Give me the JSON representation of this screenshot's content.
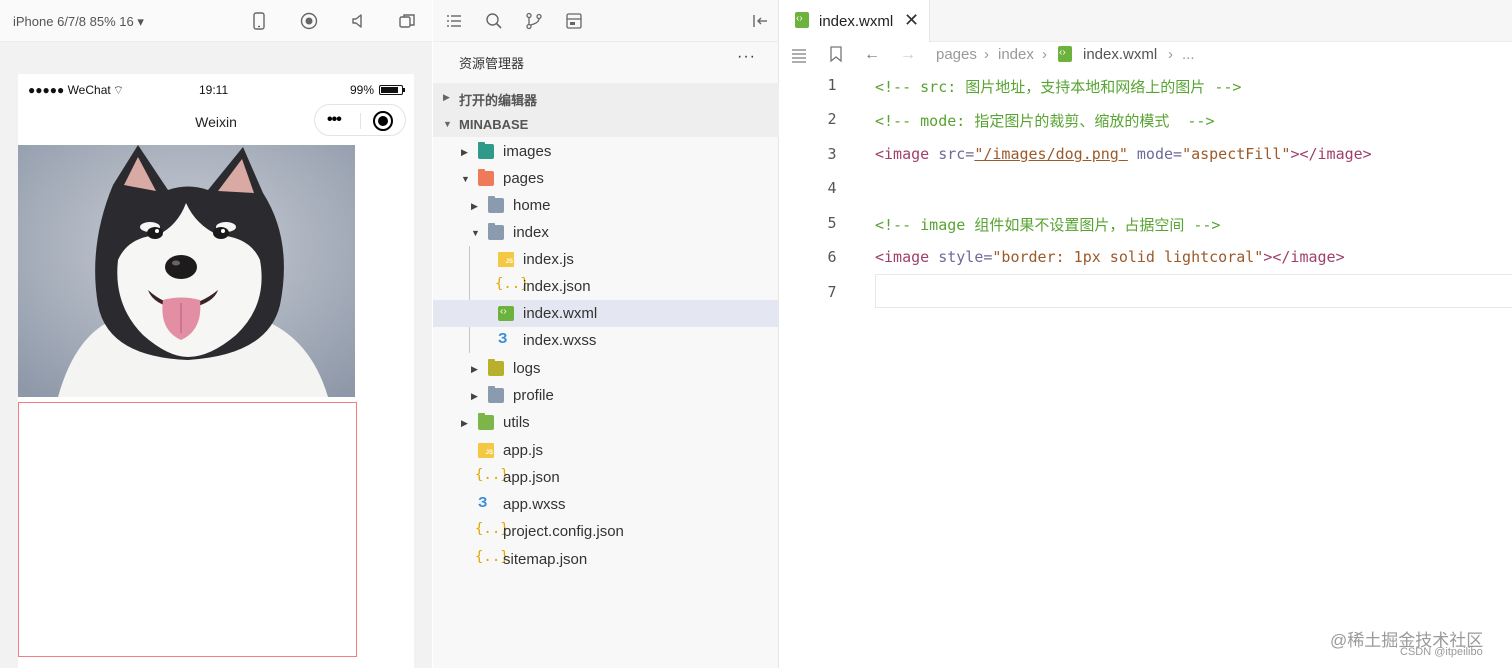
{
  "simulator": {
    "device": "iPhone 6/7/8 85% 16 ▾",
    "statusbar": {
      "carrier": "●●●●● WeChat",
      "time": "19:11",
      "battery": "99%"
    },
    "navbar_title": "Weixin",
    "capsule_dots": "•••"
  },
  "explorer": {
    "title": "资源管理器",
    "more": "···",
    "sections": {
      "open_editors": "打开的编辑器",
      "project": "MINABASE"
    },
    "tree": [
      {
        "name": "images"
      },
      {
        "name": "pages"
      },
      {
        "name": "home"
      },
      {
        "name": "index"
      },
      {
        "name": "index.js"
      },
      {
        "name": "index.json"
      },
      {
        "name": "index.wxml"
      },
      {
        "name": "index.wxss"
      },
      {
        "name": "logs"
      },
      {
        "name": "profile"
      },
      {
        "name": "utils"
      },
      {
        "name": "app.js"
      },
      {
        "name": "app.json"
      },
      {
        "name": "app.wxss"
      },
      {
        "name": "project.config.json"
      },
      {
        "name": "sitemap.json"
      }
    ],
    "selected": "index.wxml"
  },
  "editor": {
    "tab_label": "index.wxml",
    "breadcrumb": {
      "seg1": "pages",
      "seg2": "index",
      "seg3": "index.wxml",
      "ellipsis": "..."
    },
    "lines": [
      {
        "num": "1",
        "text": "<!-- src: 图片地址，支持本地和网络上的图片 -->"
      },
      {
        "num": "2",
        "text": "<!-- mode: 指定图片的裁剪、缩放的模式  -->"
      },
      {
        "num": "3",
        "tag_open": "<image ",
        "attr1": "src=",
        "val1": "\"/images/dog.png\"",
        "attr2": " mode=",
        "val2": "\"aspectFill\"",
        "tag_close": "></image>"
      },
      {
        "num": "4",
        "text": ""
      },
      {
        "num": "5",
        "text": "<!-- image 组件如果不设置图片，占据空间 -->"
      },
      {
        "num": "6",
        "tag_open": "<image ",
        "attr1": "style=",
        "val1": "\"border: 1px solid lightcoral\"",
        "tag_close": "></image>"
      },
      {
        "num": "7",
        "text": ""
      }
    ]
  },
  "watermark": {
    "main": "@稀土掘金技术社区",
    "sub": "CSDN @itpeilibo"
  },
  "colors": {
    "comment": "#58a432",
    "tag": "#a0406a",
    "attr": "#6c6a9a",
    "string": "#9b5a2a",
    "border_lightcoral": "#f08080",
    "selection": "#e4e6f1"
  }
}
